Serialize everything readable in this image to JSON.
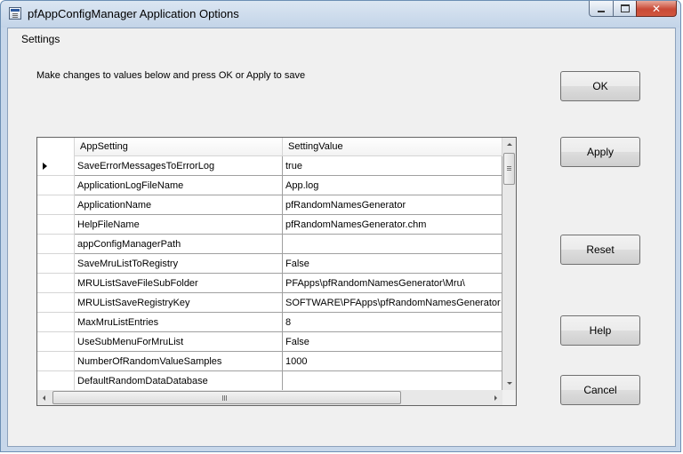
{
  "window": {
    "title": "pfAppConfigManager Application Options",
    "close_glyph": "✕"
  },
  "menu": {
    "settings": "Settings"
  },
  "instructions": "Make changes to values below and press OK or Apply to save",
  "buttons": {
    "ok": "OK",
    "apply": "Apply",
    "reset": "Reset",
    "help": "Help",
    "cancel": "Cancel"
  },
  "grid": {
    "columns": [
      "AppSetting",
      "SettingValue"
    ],
    "rows": [
      {
        "setting": "SaveErrorMessagesToErrorLog",
        "value": "true"
      },
      {
        "setting": "ApplicationLogFileName",
        "value": "App.log"
      },
      {
        "setting": "ApplicationName",
        "value": "pfRandomNamesGenerator"
      },
      {
        "setting": "HelpFileName",
        "value": "pfRandomNamesGenerator.chm"
      },
      {
        "setting": "appConfigManagerPath",
        "value": ""
      },
      {
        "setting": "SaveMruListToRegistry",
        "value": "False"
      },
      {
        "setting": "MRUListSaveFileSubFolder",
        "value": "PFApps\\pfRandomNamesGenerator\\Mru\\"
      },
      {
        "setting": "MRUListSaveRegistryKey",
        "value": "SOFTWARE\\PFApps\\pfRandomNamesGenerator"
      },
      {
        "setting": "MaxMruListEntries",
        "value": "8"
      },
      {
        "setting": "UseSubMenuForMruList",
        "value": "False"
      },
      {
        "setting": "NumberOfRandomValueSamples",
        "value": "1000"
      },
      {
        "setting": "DefaultRandomDataDatabase",
        "value": ""
      }
    ]
  }
}
